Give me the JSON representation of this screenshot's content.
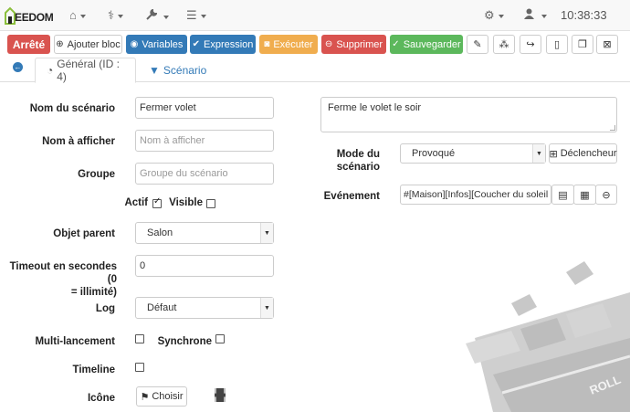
{
  "navbar": {
    "logo_text": "EEDOM",
    "time": "10:38:33",
    "items": [
      {
        "icon": "home-icon",
        "glyph": "⌂"
      },
      {
        "icon": "stethoscope-icon",
        "glyph": "⚕"
      },
      {
        "icon": "wrench-icon",
        "glyph": "🔧"
      },
      {
        "icon": "tasks-icon",
        "glyph": "☰"
      },
      {
        "icon": "cogs-icon",
        "glyph": "⚙"
      },
      {
        "icon": "user-icon",
        "glyph": "👤"
      }
    ]
  },
  "toolbar": {
    "stopped": "Arrêté",
    "add_block": "Ajouter bloc",
    "variables": "Variables",
    "expression": "Expression",
    "execute": "Exécuter",
    "delete": "Supprimer",
    "save": "Sauvegarder",
    "colors": {
      "stopped": "#d9534f",
      "info": "#337ab7",
      "warning": "#f0ad4e",
      "success": "#5cb85c"
    }
  },
  "tabs": {
    "general": "Général (ID : 4)",
    "scenario": "Scénario"
  },
  "form": {
    "name_label": "Nom du scénario",
    "name_value": "Fermer volet",
    "display_label": "Nom à afficher",
    "display_placeholder": "Nom à afficher",
    "group_label": "Groupe",
    "group_placeholder": "Groupe du scénario",
    "active_label": "Actif",
    "active_checked": true,
    "visible_label": "Visible",
    "visible_checked": false,
    "parent_label": "Objet parent",
    "parent_value": "Salon",
    "timeout_label_1": "Timeout en secondes (0",
    "timeout_label_2": "= illimité)",
    "timeout_value": "0",
    "log_label": "Log",
    "log_value": "Défaut",
    "multi_label": "Multi-lancement",
    "multi_checked": false,
    "sync_label": "Synchrone",
    "sync_checked": false,
    "timeline_label": "Timeline",
    "timeline_checked": false,
    "icon_label": "Icône",
    "choose_label": "Choisir"
  },
  "right": {
    "description": "Ferme le volet le soir",
    "mode_label_1": "Mode du",
    "mode_label_2": "scénario",
    "mode_value": "Provoqué",
    "trigger_button": "Déclencheur",
    "event_label": "Evénement",
    "event_value": "#[Maison][Infos][Coucher du soleil se"
  },
  "background": {
    "roll_text": "ROLL"
  }
}
